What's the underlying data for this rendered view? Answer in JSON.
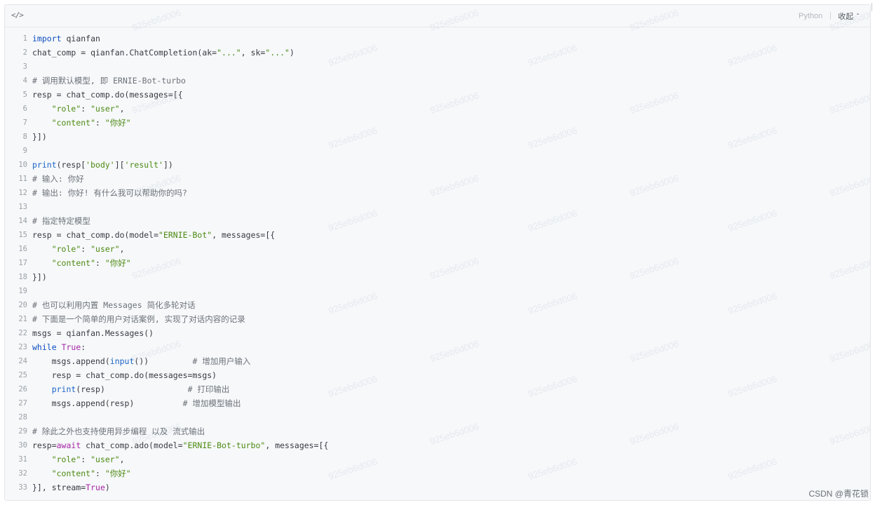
{
  "toolbar": {
    "code_icon": "</>",
    "language": "Python",
    "collapse_label": "收起",
    "collapse_icon": "chevron-up-icon"
  },
  "code": {
    "lines": [
      {
        "n": "1",
        "tokens": [
          [
            "kw",
            "import"
          ],
          [
            "plain",
            " qianfan"
          ]
        ]
      },
      {
        "n": "2",
        "tokens": [
          [
            "plain",
            "chat_comp = qianfan.ChatCompletion(ak="
          ],
          [
            "str",
            "\"...\""
          ],
          [
            "plain",
            ", sk="
          ],
          [
            "str",
            "\"...\""
          ],
          [
            "plain",
            ")"
          ]
        ]
      },
      {
        "n": "3",
        "tokens": []
      },
      {
        "n": "4",
        "tokens": [
          [
            "com",
            "# 调用默认模型, 即 ERNIE-Bot-turbo"
          ]
        ]
      },
      {
        "n": "5",
        "tokens": [
          [
            "plain",
            "resp = chat_comp.do(messages=[{"
          ]
        ]
      },
      {
        "n": "6",
        "tokens": [
          [
            "plain",
            "    "
          ],
          [
            "str",
            "\"role\""
          ],
          [
            "plain",
            ": "
          ],
          [
            "str",
            "\"user\""
          ],
          [
            "plain",
            ","
          ]
        ]
      },
      {
        "n": "7",
        "tokens": [
          [
            "plain",
            "    "
          ],
          [
            "str",
            "\"content\""
          ],
          [
            "plain",
            ": "
          ],
          [
            "str",
            "\"你好\""
          ]
        ]
      },
      {
        "n": "8",
        "tokens": [
          [
            "plain",
            "}])"
          ]
        ]
      },
      {
        "n": "9",
        "tokens": []
      },
      {
        "n": "10",
        "tokens": [
          [
            "fn",
            "print"
          ],
          [
            "plain",
            "(resp["
          ],
          [
            "str",
            "'body'"
          ],
          [
            "plain",
            "]["
          ],
          [
            "str",
            "'result'"
          ],
          [
            "plain",
            "])"
          ]
        ]
      },
      {
        "n": "11",
        "tokens": [
          [
            "com",
            "# 输入: 你好"
          ]
        ]
      },
      {
        "n": "12",
        "tokens": [
          [
            "com",
            "# 输出: 你好! 有什么我可以帮助你的吗?"
          ]
        ]
      },
      {
        "n": "13",
        "tokens": []
      },
      {
        "n": "14",
        "tokens": [
          [
            "com",
            "# 指定特定模型"
          ]
        ]
      },
      {
        "n": "15",
        "tokens": [
          [
            "plain",
            "resp = chat_comp.do(model="
          ],
          [
            "str",
            "\"ERNIE-Bot\""
          ],
          [
            "plain",
            ", messages=[{"
          ]
        ]
      },
      {
        "n": "16",
        "tokens": [
          [
            "plain",
            "    "
          ],
          [
            "str",
            "\"role\""
          ],
          [
            "plain",
            ": "
          ],
          [
            "str",
            "\"user\""
          ],
          [
            "plain",
            ","
          ]
        ]
      },
      {
        "n": "17",
        "tokens": [
          [
            "plain",
            "    "
          ],
          [
            "str",
            "\"content\""
          ],
          [
            "plain",
            ": "
          ],
          [
            "str",
            "\"你好\""
          ]
        ]
      },
      {
        "n": "18",
        "tokens": [
          [
            "plain",
            "}])"
          ]
        ]
      },
      {
        "n": "19",
        "tokens": []
      },
      {
        "n": "20",
        "tokens": [
          [
            "com",
            "# 也可以利用内置 Messages 简化多轮对话"
          ]
        ]
      },
      {
        "n": "21",
        "tokens": [
          [
            "com",
            "# 下面是一个简单的用户对话案例, 实现了对话内容的记录"
          ]
        ]
      },
      {
        "n": "22",
        "tokens": [
          [
            "plain",
            "msgs = qianfan.Messages()"
          ]
        ]
      },
      {
        "n": "23",
        "tokens": [
          [
            "kw",
            "while"
          ],
          [
            "plain",
            " "
          ],
          [
            "kw2",
            "True"
          ],
          [
            "plain",
            ":"
          ]
        ]
      },
      {
        "n": "24",
        "tokens": [
          [
            "plain",
            "    msgs.append("
          ],
          [
            "fn",
            "input"
          ],
          [
            "plain",
            "())         "
          ],
          [
            "com",
            "# 增加用户输入"
          ]
        ]
      },
      {
        "n": "25",
        "tokens": [
          [
            "plain",
            "    resp = chat_comp.do(messages=msgs)"
          ]
        ]
      },
      {
        "n": "26",
        "tokens": [
          [
            "plain",
            "    "
          ],
          [
            "fn",
            "print"
          ],
          [
            "plain",
            "(resp)                 "
          ],
          [
            "com",
            "# 打印输出"
          ]
        ]
      },
      {
        "n": "27",
        "tokens": [
          [
            "plain",
            "    msgs.append(resp)          "
          ],
          [
            "com",
            "# 增加模型输出"
          ]
        ]
      },
      {
        "n": "28",
        "tokens": []
      },
      {
        "n": "29",
        "tokens": [
          [
            "com",
            "# 除此之外也支持使用异步编程 以及 流式输出"
          ]
        ]
      },
      {
        "n": "30",
        "tokens": [
          [
            "plain",
            "resp="
          ],
          [
            "kw2",
            "await"
          ],
          [
            "plain",
            " chat_comp.ado(model="
          ],
          [
            "str",
            "\"ERNIE-Bot-turbo\""
          ],
          [
            "plain",
            ", messages=[{"
          ]
        ]
      },
      {
        "n": "31",
        "tokens": [
          [
            "plain",
            "    "
          ],
          [
            "str",
            "\"role\""
          ],
          [
            "plain",
            ": "
          ],
          [
            "str",
            "\"user\""
          ],
          [
            "plain",
            ","
          ]
        ]
      },
      {
        "n": "32",
        "tokens": [
          [
            "plain",
            "    "
          ],
          [
            "str",
            "\"content\""
          ],
          [
            "plain",
            ": "
          ],
          [
            "str",
            "\"你好\""
          ]
        ]
      },
      {
        "n": "33",
        "tokens": [
          [
            "plain",
            "}], stream="
          ],
          [
            "kw2",
            "True"
          ],
          [
            "plain",
            ")"
          ]
        ]
      }
    ]
  },
  "watermark_text": "925eb6d006",
  "credit": "CSDN @青花锁",
  "colors": {
    "keyword": "#0f4fc2",
    "keyword2": "#a626a4",
    "string": "#4d8a12",
    "comment": "#6d7278",
    "function": "#1c64c5",
    "background": "#f6f8fa"
  }
}
